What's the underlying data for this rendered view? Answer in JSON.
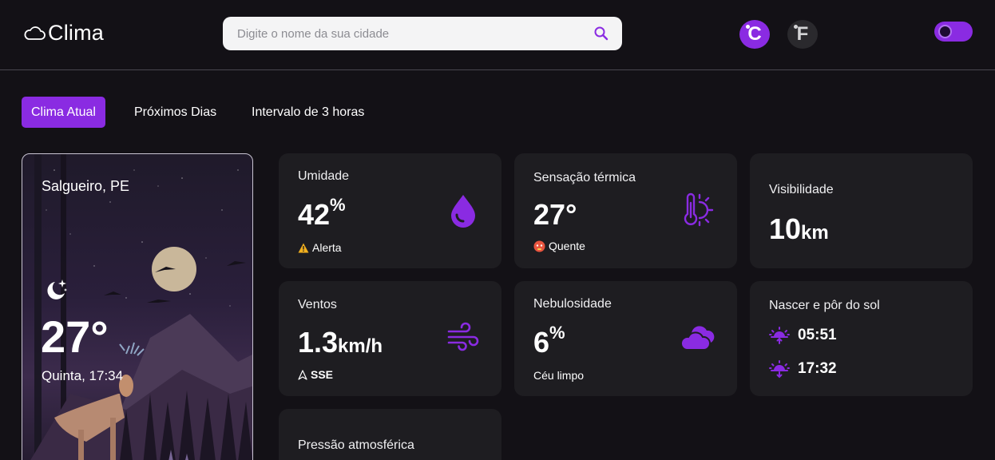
{
  "app": {
    "title": "Clima"
  },
  "search": {
    "placeholder": "Digite o nome da sua cidade",
    "value": ""
  },
  "units": {
    "celsius": "C",
    "fahrenheit": "F"
  },
  "colors": {
    "accent": "#8a2be2",
    "background": "#131116",
    "card": "#1e1d21"
  },
  "tabs": [
    {
      "label": "Clima Atual",
      "active": true
    },
    {
      "label": "Próximos Dias",
      "active": false
    },
    {
      "label": "Intervalo de 3 horas",
      "active": false
    }
  ],
  "location": {
    "city": "Salgueiro, PE",
    "temperature": "27°",
    "datetime": "Quinta, 17:34",
    "icon": "moon-stars-icon"
  },
  "cards": {
    "humidity": {
      "label": "Umidade",
      "value": "42",
      "unit": "%",
      "note": "Alerta",
      "icon": "droplet-icon"
    },
    "feels_like": {
      "label": "Sensação térmica",
      "value": "27°",
      "note": "Quente",
      "icon": "thermometer-sun-icon"
    },
    "visibility": {
      "label": "Visibilidade",
      "value": "10",
      "unit": "km"
    },
    "wind": {
      "label": "Ventos",
      "value": "1.3",
      "unit": "km/h",
      "note": "SSE",
      "icon": "wind-icon"
    },
    "clouds": {
      "label": "Nebulosidade",
      "value": "6",
      "unit": "%",
      "note": "Céu limpo",
      "icon": "cloud-icon"
    },
    "sun": {
      "label": "Nascer e pôr do sol",
      "sunrise": "05:51",
      "sunset": "17:32"
    },
    "pressure": {
      "label": "Pressão atmosférica"
    }
  }
}
